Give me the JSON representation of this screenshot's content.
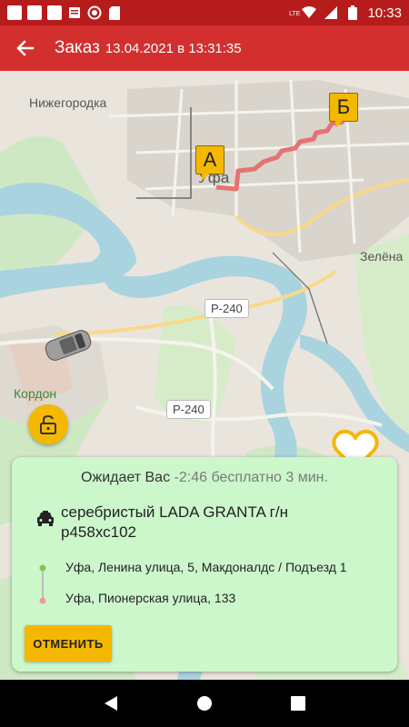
{
  "status_bar": {
    "time": "10:33",
    "network": "LTE",
    "icons": [
      "notification-square-icon",
      "notification-square-icon",
      "notification-square-icon",
      "message-icon",
      "record-icon",
      "sd-card-icon",
      "wifi-icon",
      "signal-icon",
      "battery-icon"
    ]
  },
  "app_bar": {
    "title": "Заказ",
    "subtitle": "13.04.2021 в 13:31:35"
  },
  "map": {
    "labels": {
      "nizhegorodka": "Нижегородка",
      "ufa": "Уфа",
      "zelena": "Зелёна",
      "kordon": "Кордон"
    },
    "road_shields": [
      "Р-240",
      "Р-240"
    ],
    "pin_a": "А",
    "pin_b": "Б"
  },
  "order_card": {
    "waiting_text": "Ожидает Вас",
    "timer_text": "-2:46 бесплатно 3 мин.",
    "car_description": "серебристый LADA GRANTA г/н р458хс102",
    "address_from": "Уфа, Ленина улица, 5, Макдоналдс / Подъезд 1",
    "address_to": "Уфа, Пионерская улица, 133",
    "cancel_label": "ОТМЕНИТЬ"
  },
  "colors": {
    "status_bar": "#b71c1c",
    "app_bar": "#d32f2f",
    "accent": "#f5b800",
    "card_bg": "#ccf7cb",
    "route": "#e57373"
  }
}
